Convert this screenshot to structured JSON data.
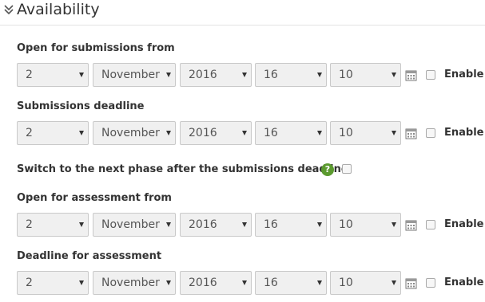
{
  "section": {
    "title": "Availability"
  },
  "fields": [
    {
      "label": "Open for submissions from",
      "day": "2",
      "month": "November",
      "year": "2016",
      "hour": "16",
      "minute": "10",
      "enable_label": "Enable"
    },
    {
      "label": "Submissions deadline",
      "day": "2",
      "month": "November",
      "year": "2016",
      "hour": "16",
      "minute": "10",
      "enable_label": "Enable"
    },
    {
      "label": "Open for assessment from",
      "day": "2",
      "month": "November",
      "year": "2016",
      "hour": "16",
      "minute": "10",
      "enable_label": "Enable"
    },
    {
      "label": "Deadline for assessment",
      "day": "2",
      "month": "November",
      "year": "2016",
      "hour": "16",
      "minute": "10",
      "enable_label": "Enable"
    }
  ],
  "phase_switch": {
    "label": "Switch to the next phase after the submissions deadline",
    "help_glyph": "?"
  },
  "icons": {
    "collapse": "double-chevron-down-icon",
    "calendar": "calendar-icon",
    "help": "help-icon"
  },
  "colors": {
    "help_green": "#5b9a2f",
    "select_bg": "#f0f0f0",
    "divider": "#e3e3e3"
  }
}
